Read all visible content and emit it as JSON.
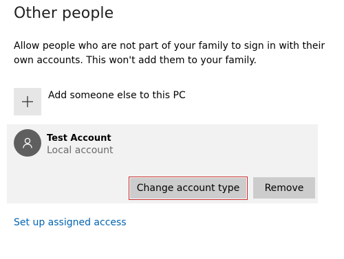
{
  "section": {
    "title": "Other people",
    "description": "Allow people who are not part of your family to sign in with their own accounts. This won't add them to your family."
  },
  "add_someone": {
    "icon": "plus-icon",
    "label": "Add someone else to this PC"
  },
  "account": {
    "avatar_icon": "person-icon",
    "name": "Test Account",
    "type": "Local account",
    "buttons": {
      "change_type": "Change account type",
      "remove": "Remove"
    }
  },
  "links": {
    "assigned_access": "Set up assigned access"
  },
  "colors": {
    "accent_link": "#0063b1",
    "button_bg": "#cccccc",
    "focus_border": "#c62828",
    "panel_bg": "#f2f2f2"
  }
}
